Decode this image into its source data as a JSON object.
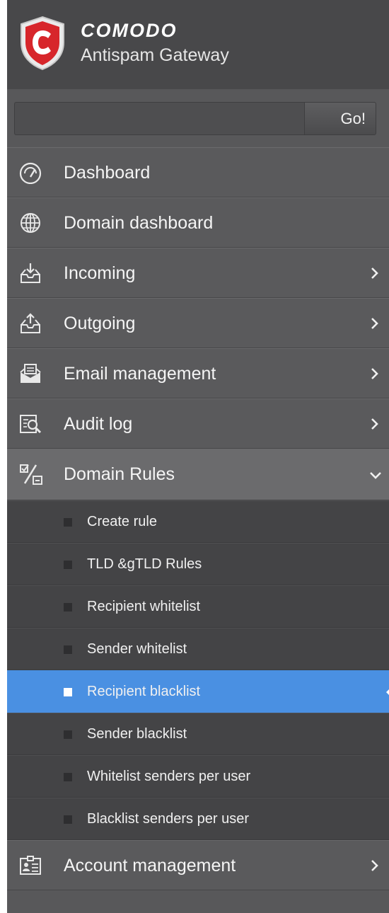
{
  "header": {
    "brand": "COMODO",
    "product": "Antispam Gateway"
  },
  "search": {
    "placeholder": "",
    "go_label": "Go!"
  },
  "menu": [
    {
      "label": "Dashboard",
      "icon": "dashboard-icon",
      "has_children": false
    },
    {
      "label": "Domain dashboard",
      "icon": "globe-icon",
      "has_children": false
    },
    {
      "label": "Incoming",
      "icon": "incoming-tray-icon",
      "has_children": true
    },
    {
      "label": "Outgoing",
      "icon": "outgoing-tray-icon",
      "has_children": true
    },
    {
      "label": "Email management",
      "icon": "email-icon",
      "has_children": true
    },
    {
      "label": "Audit log",
      "icon": "audit-log-icon",
      "has_children": true
    },
    {
      "label": "Domain Rules",
      "icon": "domain-rules-icon",
      "has_children": true,
      "expanded": true
    },
    {
      "label": "Account management",
      "icon": "account-card-icon",
      "has_children": true
    }
  ],
  "submenu": [
    {
      "label": "Create rule"
    },
    {
      "label": "TLD &gTLD Rules"
    },
    {
      "label": "Recipient whitelist"
    },
    {
      "label": "Sender whitelist"
    },
    {
      "label": "Recipient blacklist",
      "active": true
    },
    {
      "label": "Sender blacklist"
    },
    {
      "label": "Whitelist senders per user"
    },
    {
      "label": "Blacklist senders per user"
    }
  ],
  "colors": {
    "sidebar_bg": "#58585a",
    "header_bg": "#48484a",
    "active_bg": "#4a90e2",
    "submenu_bg": "#444446",
    "logo_red": "#d7262b"
  }
}
